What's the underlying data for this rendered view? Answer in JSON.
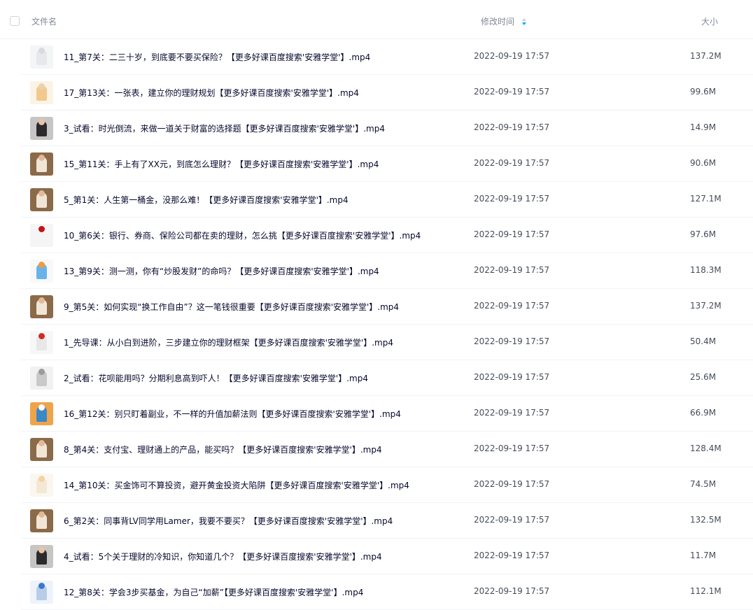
{
  "header": {
    "name_label": "文件名",
    "time_label": "修改时间",
    "size_label": "大小",
    "sort_color": "#06a7ff"
  },
  "files": [
    {
      "name": "11_第7关：二三十岁，到底要不要买保险？【更多好课百度搜索'安雅学堂'】.mp4",
      "time": "2022-09-19 17:57",
      "size": "137.2M",
      "thumb": "doc"
    },
    {
      "name": "17_第13关：一张表，建立你的理财规划【更多好课百度搜索'安雅学堂'】.mp4",
      "time": "2022-09-19 17:57",
      "size": "99.6M",
      "thumb": "table"
    },
    {
      "name": "3_试看：时光倒流，来做一道关于财富的选择题【更多好课百度搜索'安雅学堂'】.mp4",
      "time": "2022-09-19 17:57",
      "size": "14.9M",
      "thumb": "person-dark"
    },
    {
      "name": "15_第11关：手上有了XX元，到底怎么理财？【更多好课百度搜索'安雅学堂'】.mp4",
      "time": "2022-09-19 17:57",
      "size": "90.6M",
      "thumb": "person-shelf"
    },
    {
      "name": "5_第1关：人生第一桶金，没那么难！【更多好课百度搜索'安雅学堂'】.mp4",
      "time": "2022-09-19 17:57",
      "size": "127.1M",
      "thumb": "person-shelf"
    },
    {
      "name": "10_第6关：银行、券商、保险公司都在卖的理财，怎么挑【更多好课百度搜索'安雅学堂'】.mp4",
      "time": "2022-09-19 17:57",
      "size": "97.6M",
      "thumb": "red-circle"
    },
    {
      "name": "13_第9关：测一测，你有“炒股发财”的命吗？【更多好课百度搜索'安雅学堂'】.mp4",
      "time": "2022-09-19 17:57",
      "size": "118.3M",
      "thumb": "chart"
    },
    {
      "name": "9_第5关：如何实现“换工作自由”？这一笔钱很重要【更多好课百度搜索'安雅学堂'】.mp4",
      "time": "2022-09-19 17:57",
      "size": "137.2M",
      "thumb": "person-shelf"
    },
    {
      "name": "1_先导课：从小白到进阶，三步建立你的理财框架【更多好课百度搜索'安雅学堂'】.mp4",
      "time": "2022-09-19 17:57",
      "size": "50.4M",
      "thumb": "red-doc"
    },
    {
      "name": "2_试看：花呗能用吗？分期利息高到吓人！【更多好课百度搜索'安雅学堂'】.mp4",
      "time": "2022-09-19 17:57",
      "size": "25.6M",
      "thumb": "phone"
    },
    {
      "name": "16_第12关：别只盯着副业，不一样的升值加薪法则【更多好课百度搜索'安雅学堂'】.mp4",
      "time": "2022-09-19 17:57",
      "size": "66.9M",
      "thumb": "illustration"
    },
    {
      "name": "8_第4关：支付宝、理财通上的产品，能买吗？【更多好课百度搜索'安雅学堂'】.mp4",
      "time": "2022-09-19 17:57",
      "size": "128.4M",
      "thumb": "person-shelf"
    },
    {
      "name": "14_第10关：买金饰可不算投资，避开黄金投资大陷阱【更多好课百度搜索'安雅学堂'】.mp4",
      "time": "2022-09-19 17:57",
      "size": "74.5M",
      "thumb": "slide"
    },
    {
      "name": "6_第2关：同事背LV同学用Lamer，我要不要买？【更多好课百度搜索'安雅学堂'】.mp4",
      "time": "2022-09-19 17:57",
      "size": "132.5M",
      "thumb": "person-shelf"
    },
    {
      "name": "4_试看：5个关于理财的冷知识，你知道几个？【更多好课百度搜索'安雅学堂'】.mp4",
      "time": "2022-09-19 17:57",
      "size": "11.7M",
      "thumb": "person-dark"
    },
    {
      "name": "12_第8关：学会3步买基金，为自己“加薪”【更多好课百度搜索'安雅学堂'】.mp4",
      "time": "2022-09-19 17:57",
      "size": "112.1M",
      "thumb": "screen"
    }
  ]
}
